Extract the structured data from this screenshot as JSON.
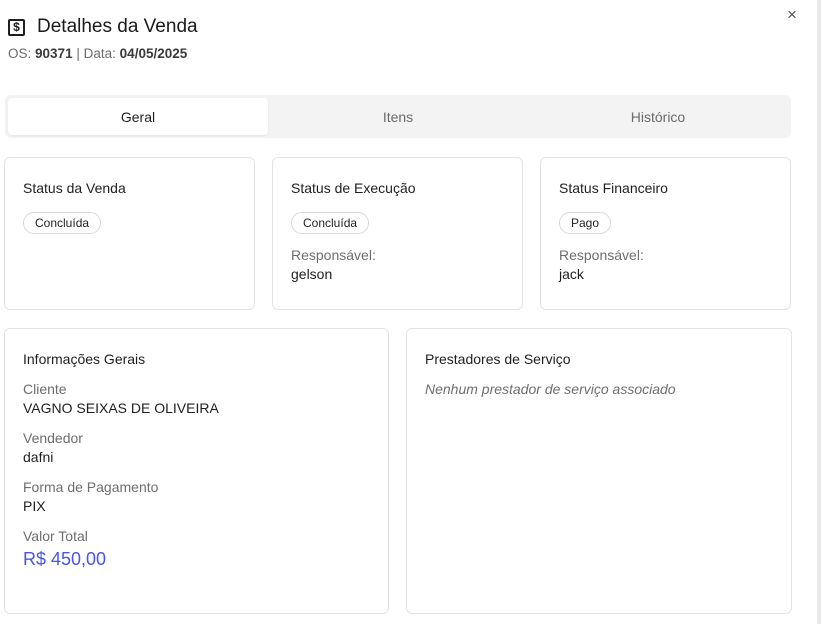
{
  "header": {
    "title": "Detalhes da Venda",
    "icon": "dollar-receipt-icon",
    "os_label": "OS:",
    "os_value": "90371",
    "separator": "|",
    "date_label": "Data:",
    "date_value": "04/05/2025"
  },
  "close_symbol": "×",
  "tabs": [
    {
      "label": "Geral",
      "active": true
    },
    {
      "label": "Itens",
      "active": false
    },
    {
      "label": "Histórico",
      "active": false
    }
  ],
  "status_venda": {
    "title": "Status da Venda",
    "badge": "Concluída"
  },
  "status_execucao": {
    "title": "Status de Execução",
    "badge": "Concluída",
    "resp_label": "Responsável:",
    "resp_value": "gelson"
  },
  "status_financeiro": {
    "title": "Status Financeiro",
    "badge": "Pago",
    "resp_label": "Responsável:",
    "resp_value": "jack"
  },
  "info": {
    "title": "Informações Gerais",
    "cliente_label": "Cliente",
    "cliente_value": "VAGNO SEIXAS DE OLIVEIRA",
    "vendedor_label": "Vendedor",
    "vendedor_value": "dafni",
    "pagamento_label": "Forma de Pagamento",
    "pagamento_value": "PIX",
    "valor_label": "Valor Total",
    "valor_value": "R$ 450,00"
  },
  "prestadores": {
    "title": "Prestadores de Serviço",
    "empty": "Nenhum prestador de serviço associado"
  },
  "colors": {
    "accent": "#4a56e2",
    "border": "#e3e3e6",
    "tabs_bg": "#f3f3f4"
  }
}
